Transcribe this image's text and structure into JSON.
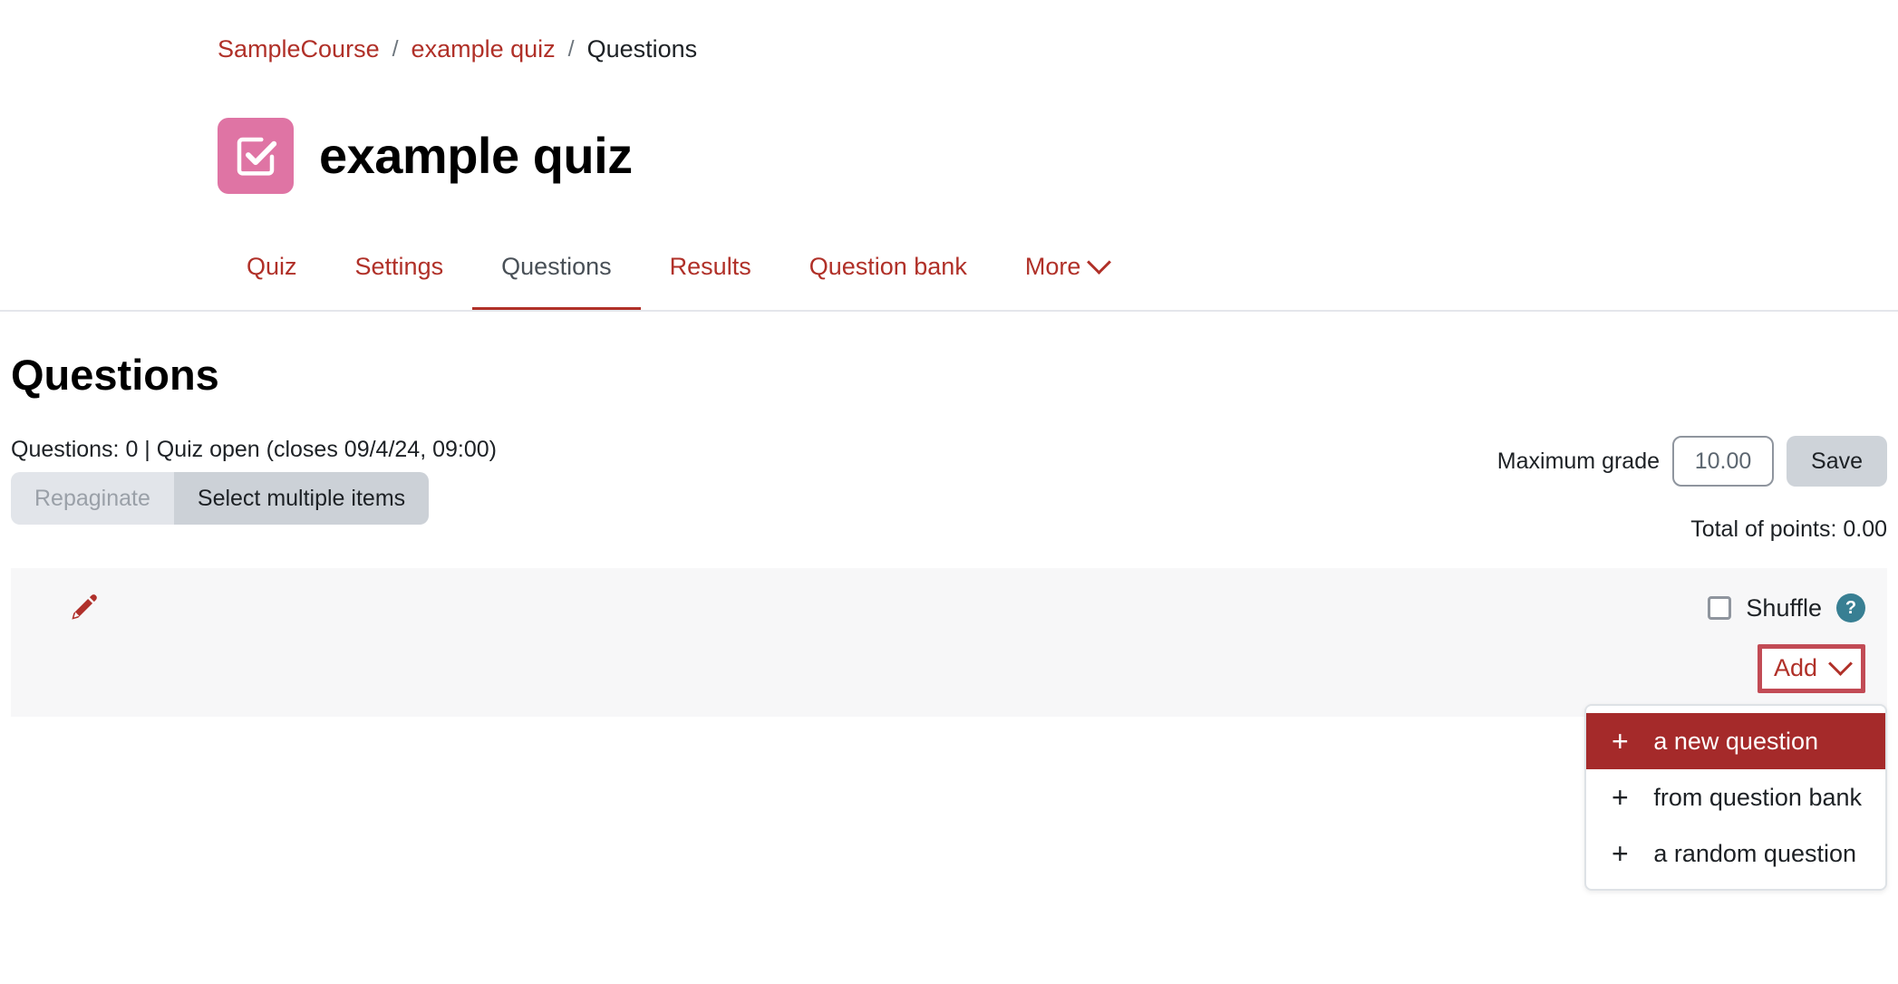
{
  "breadcrumb": {
    "items": [
      {
        "label": "SampleCourse",
        "type": "link"
      },
      {
        "label": "example quiz",
        "type": "link"
      },
      {
        "label": "Questions",
        "type": "current"
      }
    ],
    "separator": "/"
  },
  "header": {
    "title": "example quiz",
    "icon": "quiz-checkbox-icon",
    "icon_color": "#df74a4"
  },
  "tabs": [
    {
      "label": "Quiz",
      "active": false
    },
    {
      "label": "Settings",
      "active": false
    },
    {
      "label": "Questions",
      "active": true
    },
    {
      "label": "Results",
      "active": false
    },
    {
      "label": "Question bank",
      "active": false
    },
    {
      "label": "More",
      "active": false,
      "has_chevron": true
    }
  ],
  "main": {
    "section_title": "Questions",
    "quiz_status": "Questions: 0 | Quiz open (closes 09/4/24, 09:00)",
    "grade": {
      "label": "Maximum grade",
      "value": "10.00",
      "save_label": "Save"
    },
    "total_points": "Total of points: 0.00",
    "actions": {
      "repaginate_label": "Repaginate",
      "select_multiple_label": "Select multiple items"
    }
  },
  "section": {
    "edit_icon": "pencil-icon",
    "shuffle_label": "Shuffle",
    "shuffle_checked": false,
    "help_icon_label": "?",
    "add_label": "Add"
  },
  "dropdown": {
    "items": [
      {
        "label": "a new question",
        "icon": "plus-icon",
        "highlighted": true
      },
      {
        "label": "from question bank",
        "icon": "plus-icon",
        "highlighted": false
      },
      {
        "label": "a random question",
        "icon": "plus-icon",
        "highlighted": false
      }
    ]
  },
  "colors": {
    "brand_red": "#b03028",
    "highlight_red": "#a52a2a",
    "annotation_border": "#c24b55",
    "activity_pink": "#df74a4",
    "help_teal": "#387f93",
    "band_bg": "#f7f7f8"
  }
}
